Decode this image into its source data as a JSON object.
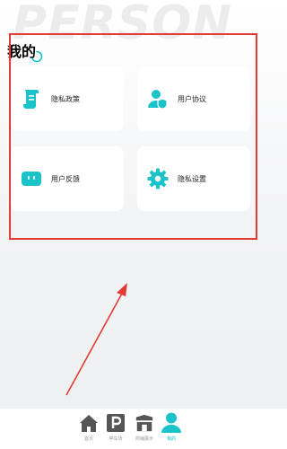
{
  "header": {
    "watermark": "PERSON",
    "title": "我的"
  },
  "cards": [
    {
      "label": "隐私政策",
      "icon": "scroll-icon"
    },
    {
      "label": "用户协议",
      "icon": "user-shield-icon"
    },
    {
      "label": "用户反馈",
      "icon": "robot-face-icon"
    },
    {
      "label": "隐私设置",
      "icon": "gear-icon"
    }
  ],
  "tabbar": {
    "tabs": [
      {
        "label": "首页",
        "icon": "home-icon",
        "active": false
      },
      {
        "label": "停车场",
        "icon": "parking-icon",
        "active": false
      },
      {
        "label": "商铺展示",
        "icon": "storefront-icon",
        "active": false
      },
      {
        "label": "我的",
        "icon": "person-icon",
        "active": true
      }
    ]
  },
  "colors": {
    "accent": "#19c3c9",
    "tab_inactive": "#555555",
    "annotation": "#e53935"
  }
}
